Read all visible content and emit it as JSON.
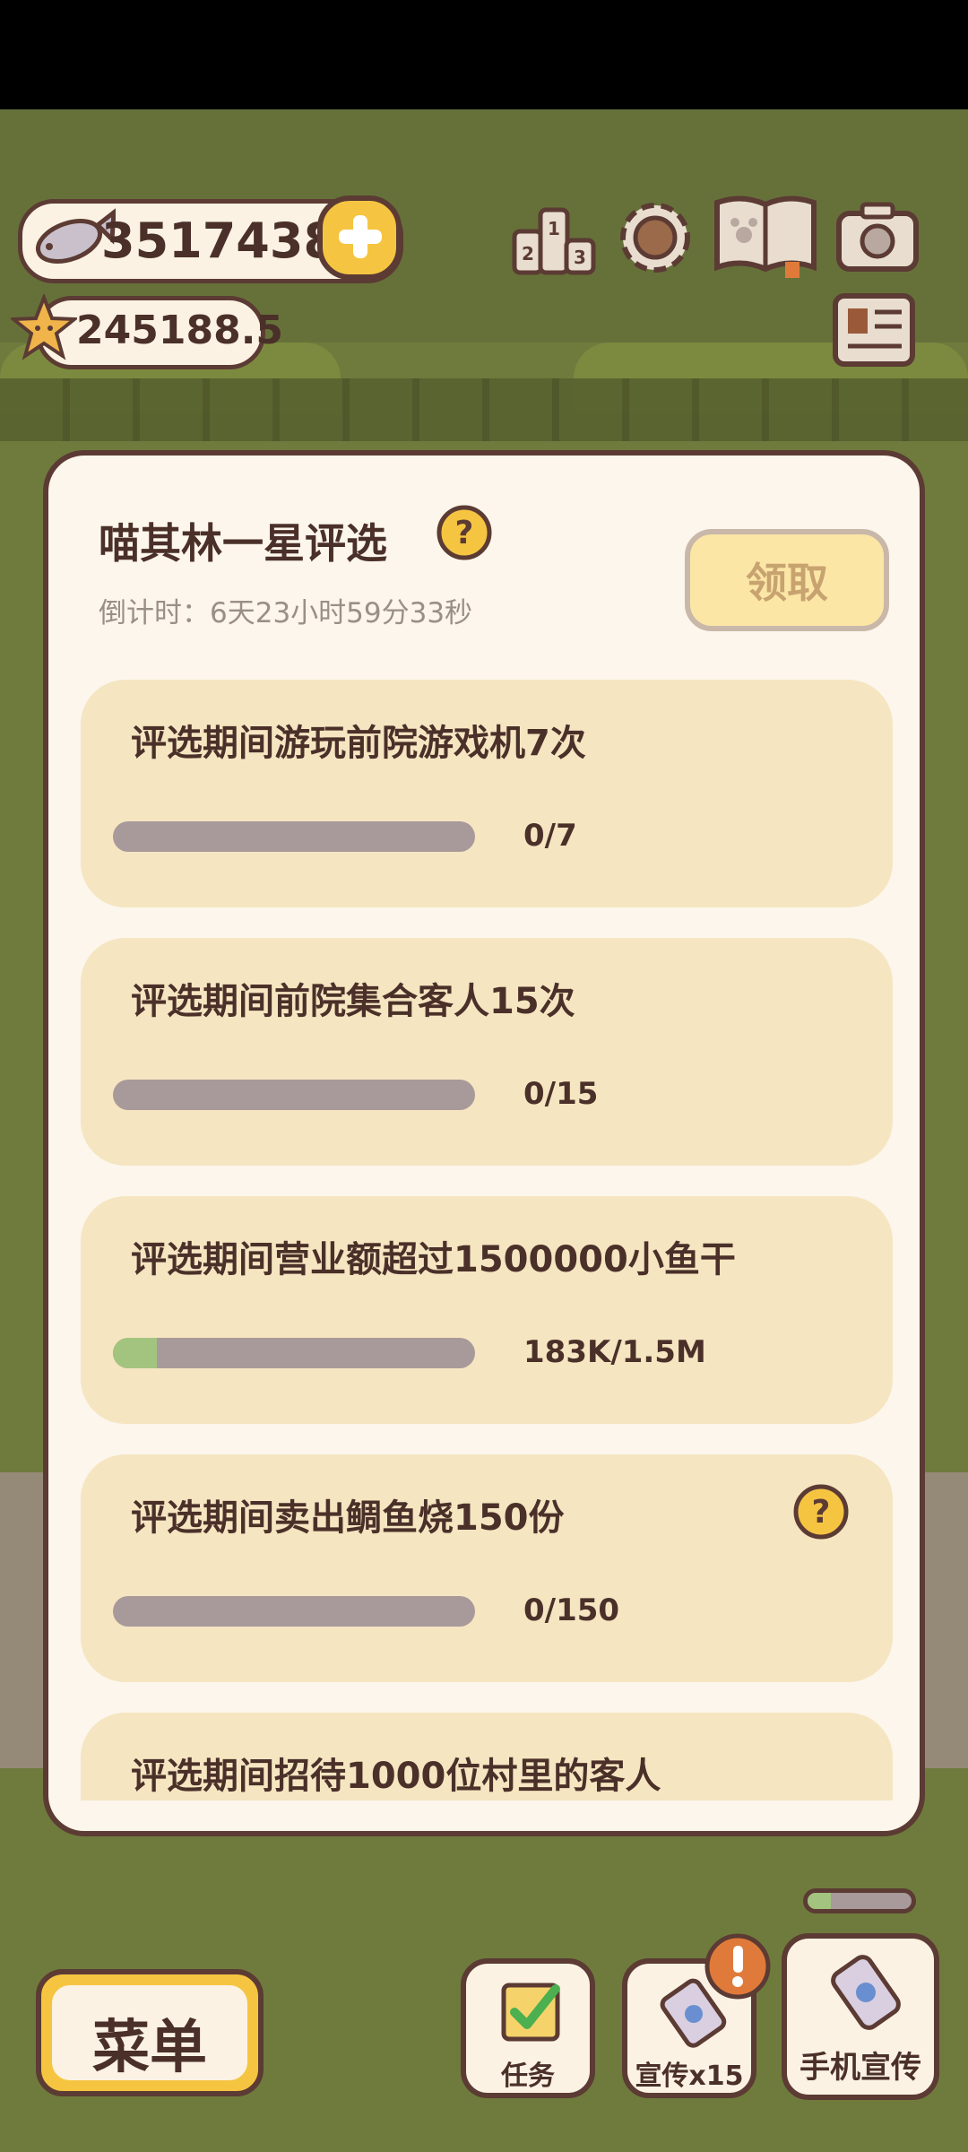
{
  "hud": {
    "fish_count": "35174388",
    "star_count": "245188.5",
    "icons": [
      "fish-icon",
      "plus-icon",
      "star-icon",
      "ranking-icon",
      "gear-icon",
      "paw-book-icon",
      "camera-icon",
      "newspaper-icon"
    ]
  },
  "modal": {
    "title": "喵其林一星评选",
    "countdown": "倒计时：6天23小时59分33秒",
    "claim_label": "领取",
    "tasks": [
      {
        "title": "评选期间游玩前院游戏机7次",
        "progress_text": "0/7",
        "progress": 0.0,
        "has_help": false
      },
      {
        "title": "评选期间前院集合客人15次",
        "progress_text": "0/15",
        "progress": 0.0,
        "has_help": false
      },
      {
        "title": "评选期间营业额超过1500000小鱼干",
        "progress_text": "183K/1.5M",
        "progress": 0.122,
        "has_help": false
      },
      {
        "title": "评选期间卖出鲷鱼烧150份",
        "progress_text": "0/150",
        "progress": 0.0,
        "has_help": true
      },
      {
        "title": "评选期间招待1000位村里的客人",
        "progress_text": "",
        "progress": 0.0,
        "has_help": false
      }
    ]
  },
  "bottom": {
    "menu_label": "菜单",
    "tasks_label": "任务",
    "promo_label": "宣传x15",
    "phone_promo_label": "手机宣传"
  },
  "colors": {
    "outline": "#5b3b33",
    "card": "#f5e5c1",
    "progress_fill": "#a3c47f",
    "progress_track": "#a8999a",
    "accent_yellow": "#f5c542"
  }
}
